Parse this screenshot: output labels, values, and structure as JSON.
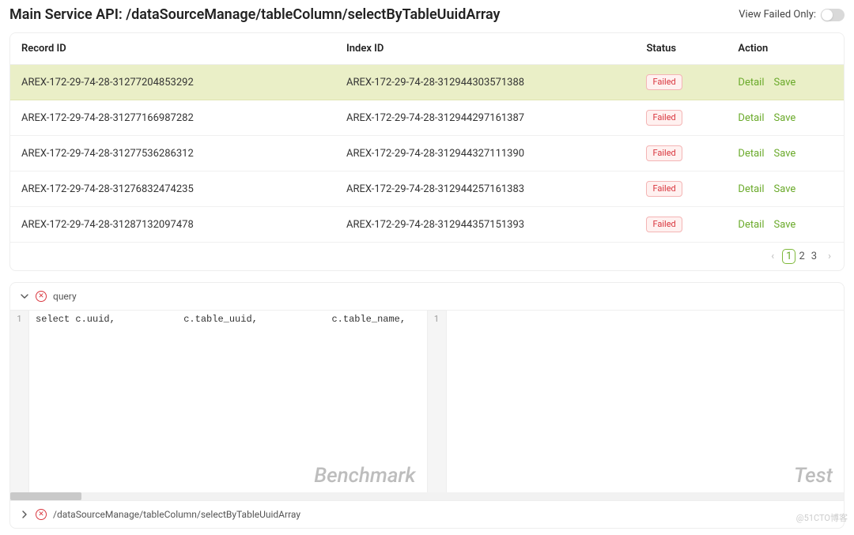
{
  "header": {
    "title": "Main Service API: /dataSourceManage/tableColumn/selectByTableUuidArray",
    "toggle_label": "View Failed Only:"
  },
  "table": {
    "columns": {
      "record_id": "Record ID",
      "index_id": "Index ID",
      "status": "Status",
      "action": "Action"
    },
    "status_failed": "Failed",
    "action_detail": "Detail",
    "action_save": "Save",
    "rows": [
      {
        "record_id": "AREX-172-29-74-28-31277204853292",
        "index_id": "AREX-172-29-74-28-312944303571388",
        "status": "Failed",
        "highlight": true
      },
      {
        "record_id": "AREX-172-29-74-28-31277166987282",
        "index_id": "AREX-172-29-74-28-312944297161387",
        "status": "Failed",
        "highlight": false
      },
      {
        "record_id": "AREX-172-29-74-28-31277536286312",
        "index_id": "AREX-172-29-74-28-312944327111390",
        "status": "Failed",
        "highlight": false
      },
      {
        "record_id": "AREX-172-29-74-28-31276832474235",
        "index_id": "AREX-172-29-74-28-312944257161383",
        "status": "Failed",
        "highlight": false
      },
      {
        "record_id": "AREX-172-29-74-28-31287132097478",
        "index_id": "AREX-172-29-74-28-312944357151393",
        "status": "Failed",
        "highlight": false
      }
    ]
  },
  "pagination": {
    "pages": [
      "1",
      "2",
      "3"
    ],
    "current": "1"
  },
  "detail": {
    "head_label": "query",
    "benchmark_label": "Benchmark",
    "test_label": "Test",
    "line_no": "1",
    "code_line": "select c.uuid,            c.table_uuid,             c.table_name,",
    "foot_path": "/dataSourceManage/tableColumn/selectByTableUuidArray"
  },
  "attribution": "@51CTO博客"
}
